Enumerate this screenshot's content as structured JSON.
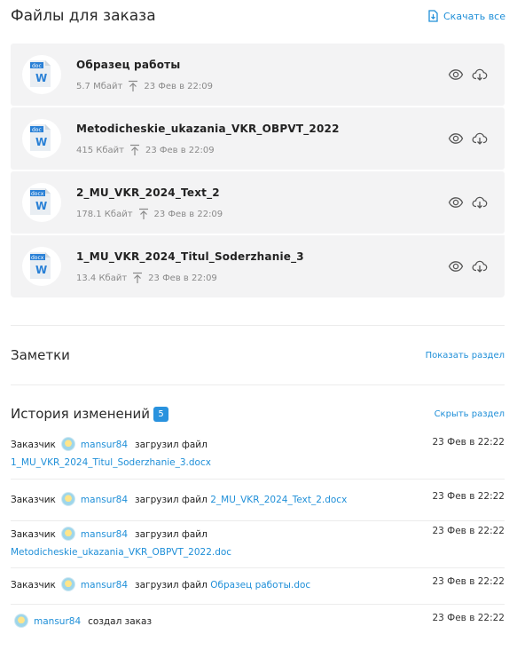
{
  "files_section": {
    "title": "Файлы для заказа",
    "download_all": "Скачать все"
  },
  "files": [
    {
      "name": "Образец работы",
      "ext": "doc",
      "size": "5.7 Мбайт",
      "date": "23 Фев в 22:09"
    },
    {
      "name": "Metodicheskie_ukazania_VKR_OBPVT_2022",
      "ext": "doc",
      "size": "415 Кбайт",
      "date": "23 Фев в 22:09"
    },
    {
      "name": "2_MU_VKR_2024_Text_2",
      "ext": "docx",
      "size": "178.1 Кбайт",
      "date": "23 Фев в 22:09"
    },
    {
      "name": "1_MU_VKR_2024_Titul_Soderzhanie_3",
      "ext": "docx",
      "size": "13.4 Кбайт",
      "date": "23 Фев в 22:09"
    }
  ],
  "notes": {
    "title": "Заметки",
    "link": "Показать раздел"
  },
  "history": {
    "title": "История изменений",
    "count": "5",
    "link": "Скрыть раздел",
    "items": [
      {
        "role": "Заказчик",
        "user": "mansur84",
        "action": "загрузил файл",
        "file": "1_MU_VKR_2024_Titul_Soderzhanie_3.docx",
        "date": "23 Фев в 22:22"
      },
      {
        "role": "Заказчик",
        "user": "mansur84",
        "action": "загрузил файл",
        "file": "2_MU_VKR_2024_Text_2.docx",
        "date": "23 Фев в 22:22"
      },
      {
        "role": "Заказчик",
        "user": "mansur84",
        "action": "загрузил файл",
        "file": "Metodicheskie_ukazania_VKR_OBPVT_2022.doc",
        "date": "23 Фев в 22:22"
      },
      {
        "role": "Заказчик",
        "user": "mansur84",
        "action": "загрузил файл",
        "file": "Образец работы.doc",
        "date": "23 Фев в 22:22"
      },
      {
        "role": "",
        "user": "mansur84",
        "action": "создал заказ",
        "file": "",
        "date": "23 Фев в 22:22"
      }
    ]
  },
  "colors": {
    "accent": "#1f8fd8",
    "card_bg": "#f3f3f4",
    "badge": "#2992de"
  },
  "icons": [
    "file-download-icon",
    "word-doc-icon",
    "upload-arrow-icon",
    "eye-icon",
    "cloud-download-icon",
    "user-avatar-icon"
  ]
}
